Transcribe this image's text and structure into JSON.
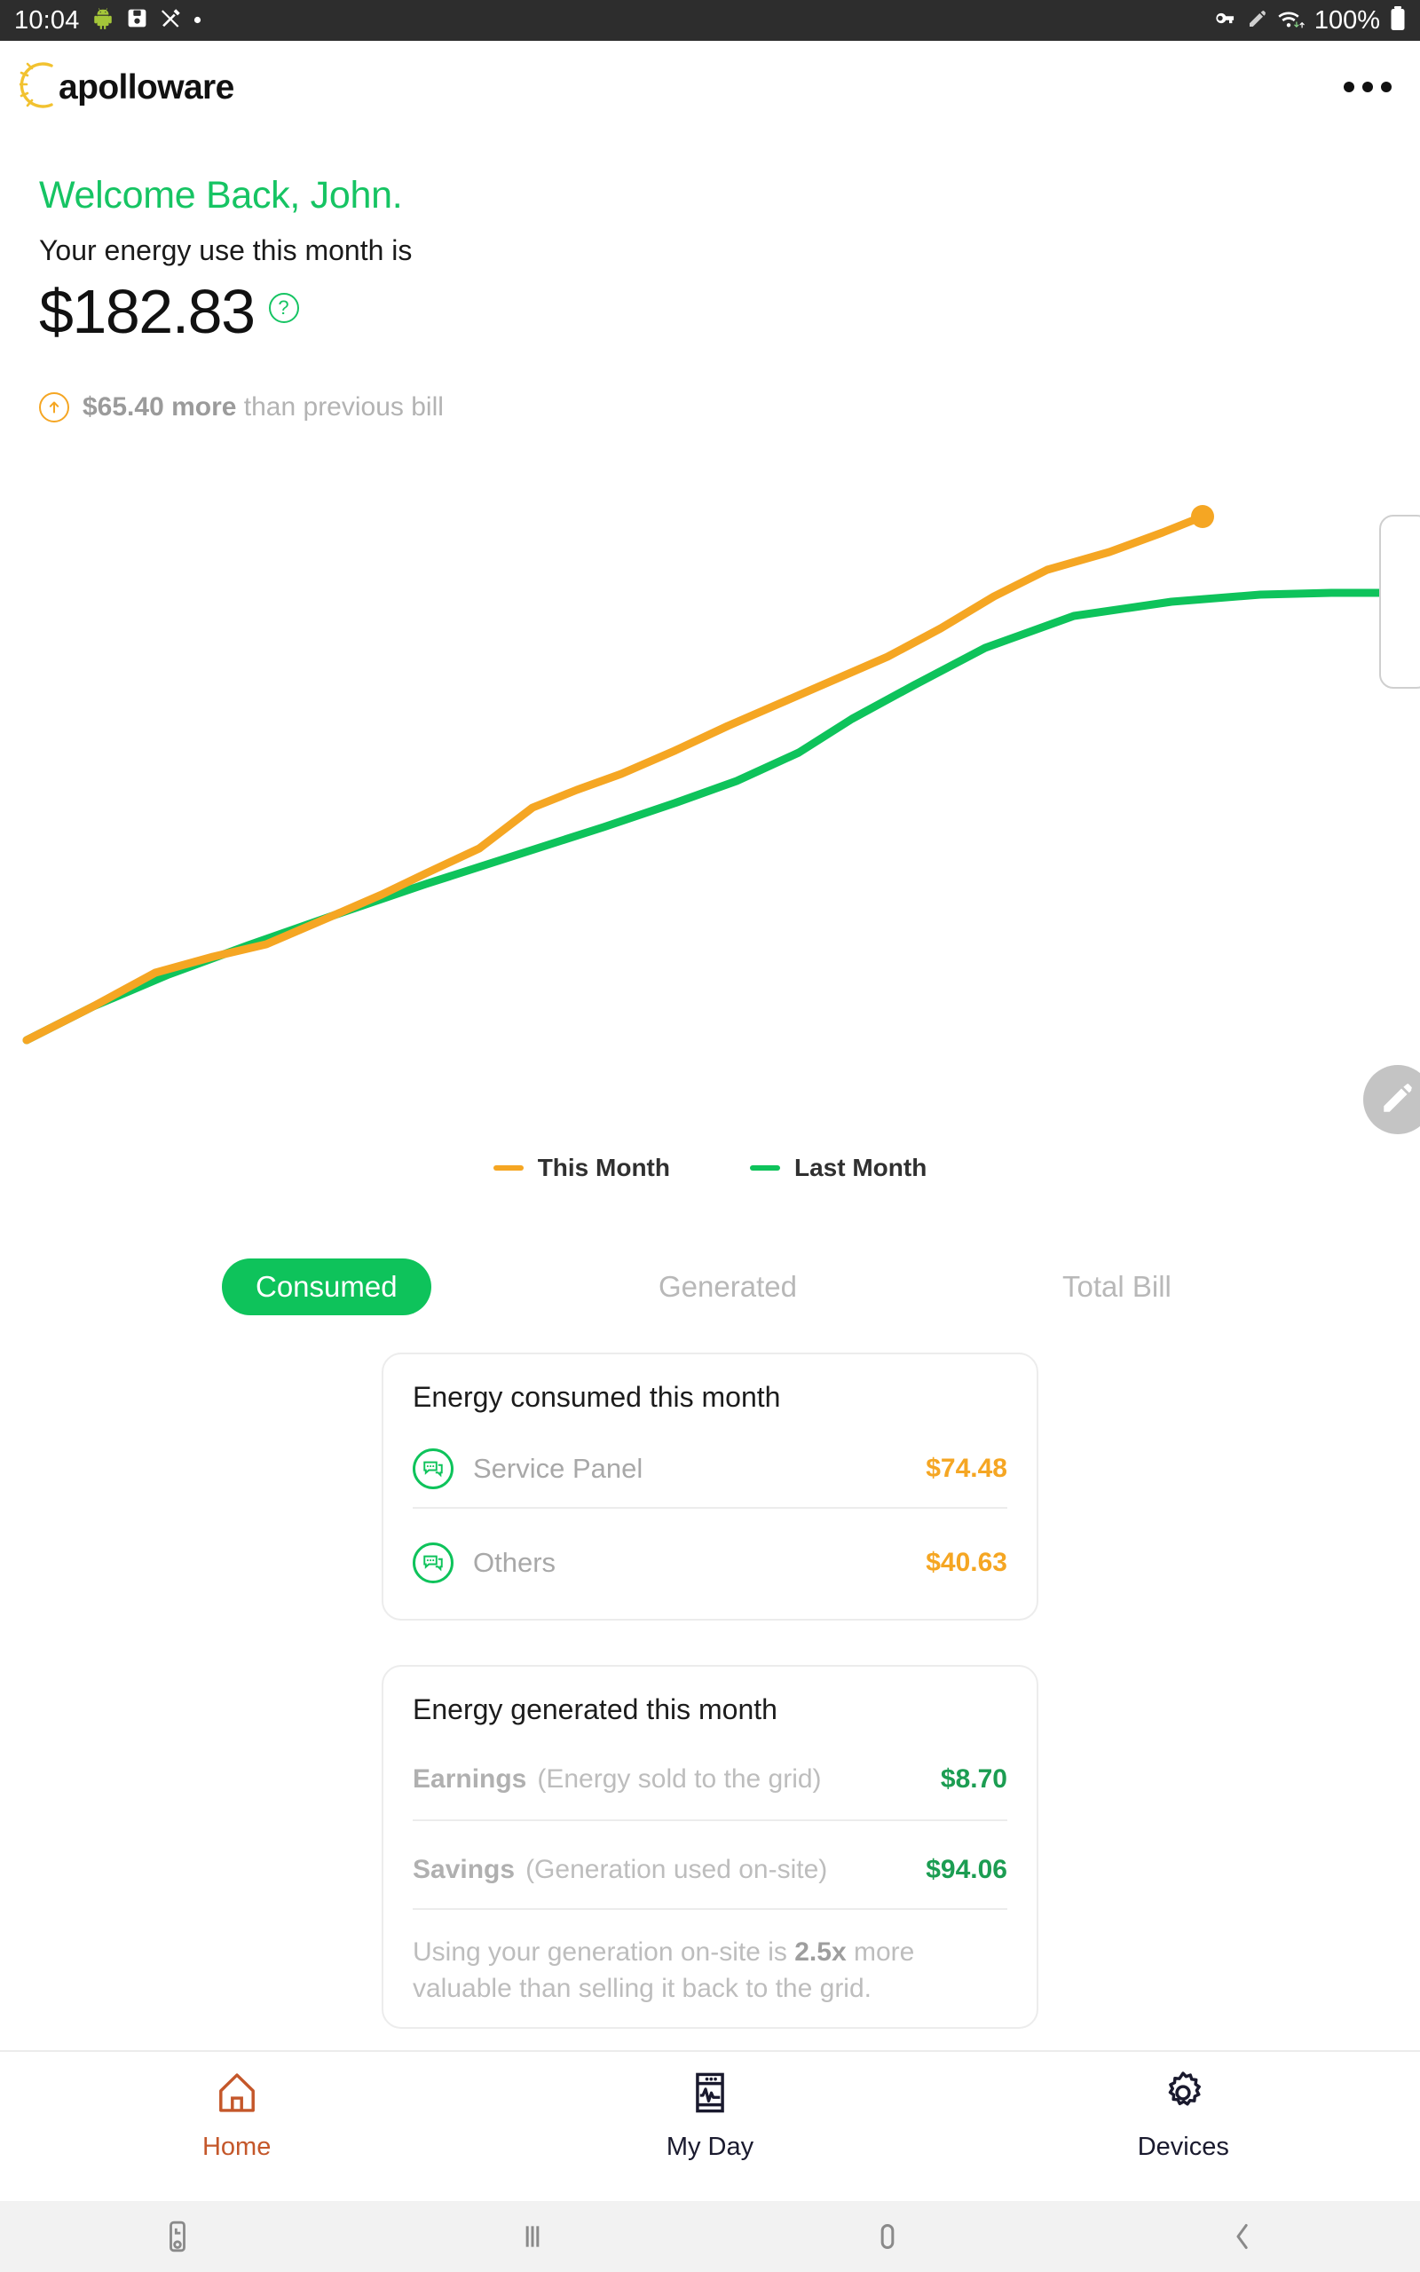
{
  "status_bar": {
    "time": "10:04",
    "battery_percent": "100%",
    "left_icons": [
      "android-robot-icon",
      "save-icon",
      "crossed-pen-icon",
      "dot-icon"
    ],
    "right_icons": [
      "vpn-key-icon",
      "pencil-icon",
      "wifi-icon",
      "battery-icon"
    ]
  },
  "app_bar": {
    "logo_text": "apolloware",
    "overflow_label": "more-options"
  },
  "hero": {
    "welcome": "Welcome Back, John.",
    "use_label": "Your energy use this month is",
    "amount": "$182.83",
    "help_glyph": "?",
    "delta_amount": "$65.40 more",
    "delta_suffix": " than previous bill"
  },
  "chart_data": {
    "type": "line",
    "title": "",
    "xlabel": "",
    "ylabel": "",
    "grid": false,
    "legend_position": "bottom-center",
    "x": [
      0,
      1,
      2,
      3,
      4,
      5,
      6,
      7,
      8,
      9,
      10,
      11,
      12,
      13,
      14,
      15,
      16
    ],
    "series": [
      {
        "name": "This Month",
        "color": "#f5a623",
        "values": [
          2,
          10,
          20,
          29,
          36,
          44,
          53,
          62,
          70,
          79,
          88,
          96,
          105,
          115,
          128,
          141,
          152
        ],
        "end_marker": true
      },
      {
        "name": "Last Month",
        "color": "#0ec35b",
        "values": [
          2,
          9,
          17,
          24,
          31,
          37,
          43,
          50,
          56,
          62,
          68,
          74,
          80,
          89,
          100,
          109,
          111
        ]
      }
    ],
    "ylim": [
      0,
      165
    ],
    "xlim": [
      0,
      16
    ]
  },
  "legend": [
    {
      "label": "This Month",
      "color": "#f5a623"
    },
    {
      "label": "Last Month",
      "color": "#0ec35b"
    }
  ],
  "tabs": [
    {
      "label": "Consumed",
      "active": true
    },
    {
      "label": "Generated",
      "active": false
    },
    {
      "label": "Total Bill",
      "active": false
    }
  ],
  "card_consumed": {
    "title": "Energy consumed this month",
    "rows": [
      {
        "icon": "chat-bubble-icon",
        "label": "Service Panel",
        "value": "$74.48"
      },
      {
        "icon": "chat-bubble-icon",
        "label": "Others",
        "value": "$40.63"
      }
    ]
  },
  "card_generated": {
    "title": "Energy generated this month",
    "rows": [
      {
        "label": "Earnings",
        "sub": "(Energy sold to the grid)",
        "value": "$8.70"
      },
      {
        "label": "Savings",
        "sub": "(Generation used on-site)",
        "value": "$94.06"
      }
    ],
    "note_part1": "Using your generation on-site is ",
    "note_strong": "2.5x",
    "note_part2": " more valuable than selling it back to the grid."
  },
  "bottom_nav": [
    {
      "label": "Home",
      "icon": "house-icon",
      "active": true
    },
    {
      "label": "My Day",
      "icon": "monitor-chart-icon",
      "active": false
    },
    {
      "label": "Devices",
      "icon": "gear-icon",
      "active": false
    }
  ],
  "system_nav": [
    {
      "name": "screenshot-icon"
    },
    {
      "name": "recents-icon"
    },
    {
      "name": "home-circle-icon"
    },
    {
      "name": "back-chevron-icon"
    }
  ],
  "floating_action": {
    "icon": "pencil-edit-icon"
  },
  "colors": {
    "brand_green": "#0ec35b",
    "accent_orange": "#f5a623",
    "value_green": "#1c9d52",
    "nav_active": "#c4572a",
    "nav_idle": "#1a1a2e"
  }
}
